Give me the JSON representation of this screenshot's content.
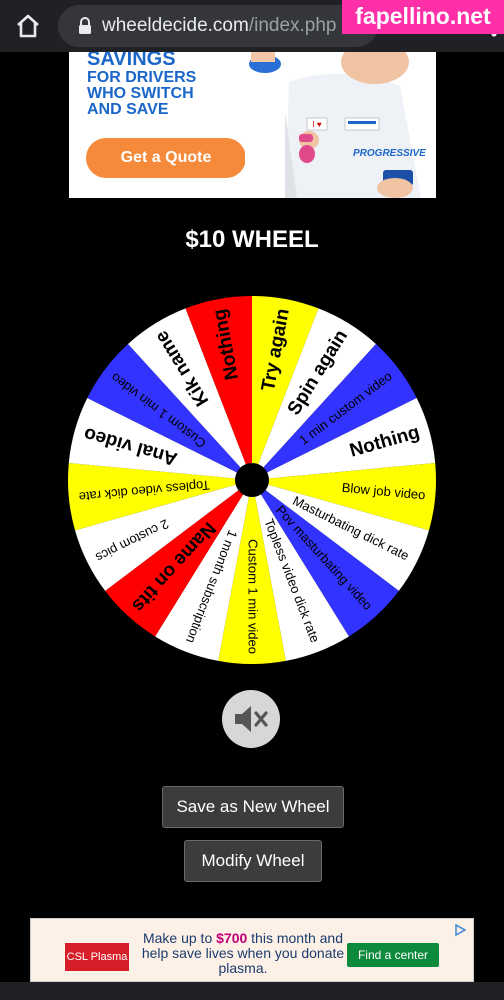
{
  "browser": {
    "url_domain": "wheeldecide.com",
    "url_path": "/index.php",
    "watermark": "fapellino.net"
  },
  "top_ad": {
    "headline_cut": "SAVINGS",
    "lines": [
      "FOR DRIVERS",
      "WHO SWITCH",
      "AND SAVE"
    ],
    "cta": "Get a Quote",
    "brand": "PROGRESSIVE"
  },
  "wheel": {
    "title": "$10 WHEEL",
    "colors": [
      "#ffff00",
      "#ffffff",
      "#3333ff",
      "#ffffff",
      "#ffff00",
      "#ffffff",
      "#3333ff",
      "#ffffff",
      "#ffff00",
      "#ffffff",
      "#ff0000",
      "#ffffff",
      "#ffff00",
      "#ffffff",
      "#3333ff",
      "#ffffff",
      "#ff0000",
      "#ffffff"
    ],
    "segments": [
      "Try again",
      "Spin again",
      "1 min custom video",
      "Nothing",
      "Blow job video",
      "Masturbating dick rate",
      "Pov masturbating video",
      "Topless video dick rate",
      "Custom 1 min video",
      "1 month subscription",
      "Name on tits",
      "2 custom pics",
      "Topless video dick rate",
      "Anal video",
      "Custom 1 min video",
      "Kik name",
      "Nothing"
    ]
  },
  "controls": {
    "mute_icon": "speaker-muted-icon",
    "save_label": "Save as New Wheel",
    "modify_label": "Modify Wheel"
  },
  "bottom_ad": {
    "logo": "CSL Plasma",
    "text_before": "Make up to ",
    "amount": "$700",
    "text_after": " this month and help save lives when you donate plasma.",
    "cta": "Find a center"
  }
}
